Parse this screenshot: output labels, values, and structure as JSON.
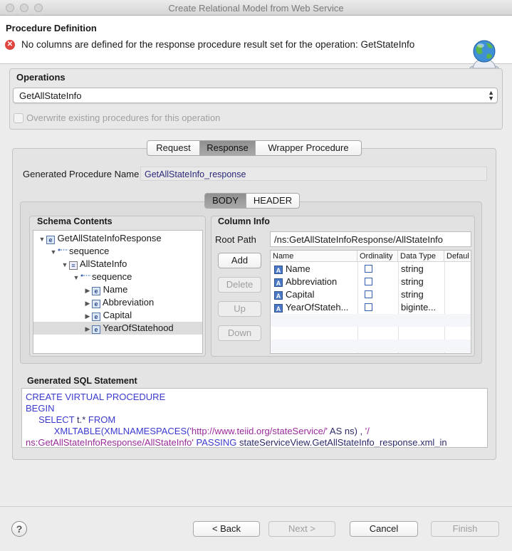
{
  "window": {
    "title": "Create Relational Model from Web Service"
  },
  "header": {
    "title": "Procedure Definition",
    "error": "No columns are defined for the response procedure result set for the operation: GetStateInfo"
  },
  "operations": {
    "label": "Operations",
    "selected": "GetAllStateInfo",
    "overwrite_label": "Overwrite existing procedures for this operation"
  },
  "tabs": [
    "Request",
    "Response",
    "Wrapper Procedure"
  ],
  "generated_name": {
    "label": "Generated Procedure Name",
    "value": "GetAllStateInfo_response"
  },
  "subtabs": [
    "BODY",
    "HEADER"
  ],
  "schema": {
    "label": "Schema Contents",
    "items": [
      "GetAllStateInfoResponse",
      "sequence",
      "AllStateInfo",
      "sequence",
      "Name",
      "Abbreviation",
      "Capital",
      "YearOfStatehood"
    ]
  },
  "column_info": {
    "label": "Column Info",
    "root_path_label": "Root Path",
    "root_path": "/ns:GetAllStateInfoResponse/AllStateInfo",
    "buttons": [
      "Add",
      "Delete",
      "Up",
      "Down"
    ],
    "headers": [
      "Name",
      "Ordinality",
      "Data Type",
      "Defaul"
    ],
    "rows": [
      {
        "name": "Name",
        "type": "string"
      },
      {
        "name": "Abbreviation",
        "type": "string"
      },
      {
        "name": "Capital",
        "type": "string"
      },
      {
        "name": "YearOfStateh...",
        "type": "biginte..."
      }
    ]
  },
  "sql": {
    "label": "Generated SQL Statement",
    "l1": "CREATE VIRTUAL PROCEDURE",
    "l2": "BEGIN",
    "l3a": "SELECT",
    "l3b": " t.* ",
    "l3c": "FROM",
    "l4a": "XMLTABLE(XMLNAMESPACES(",
    "l4b": "'http://www.teiid.org/stateService/'",
    "l4c": " AS ns) , ",
    "l4d": "'/",
    "l5a": "ns:GetAllStateInfoResponse/AllStateInfo'",
    "l5b": " PASSING ",
    "l5c": "stateServiceView.GetAllStateInfo_response.xml_in"
  },
  "footer": {
    "back": "< Back",
    "next": "Next >",
    "cancel": "Cancel",
    "finish": "Finish",
    "help": "?"
  }
}
